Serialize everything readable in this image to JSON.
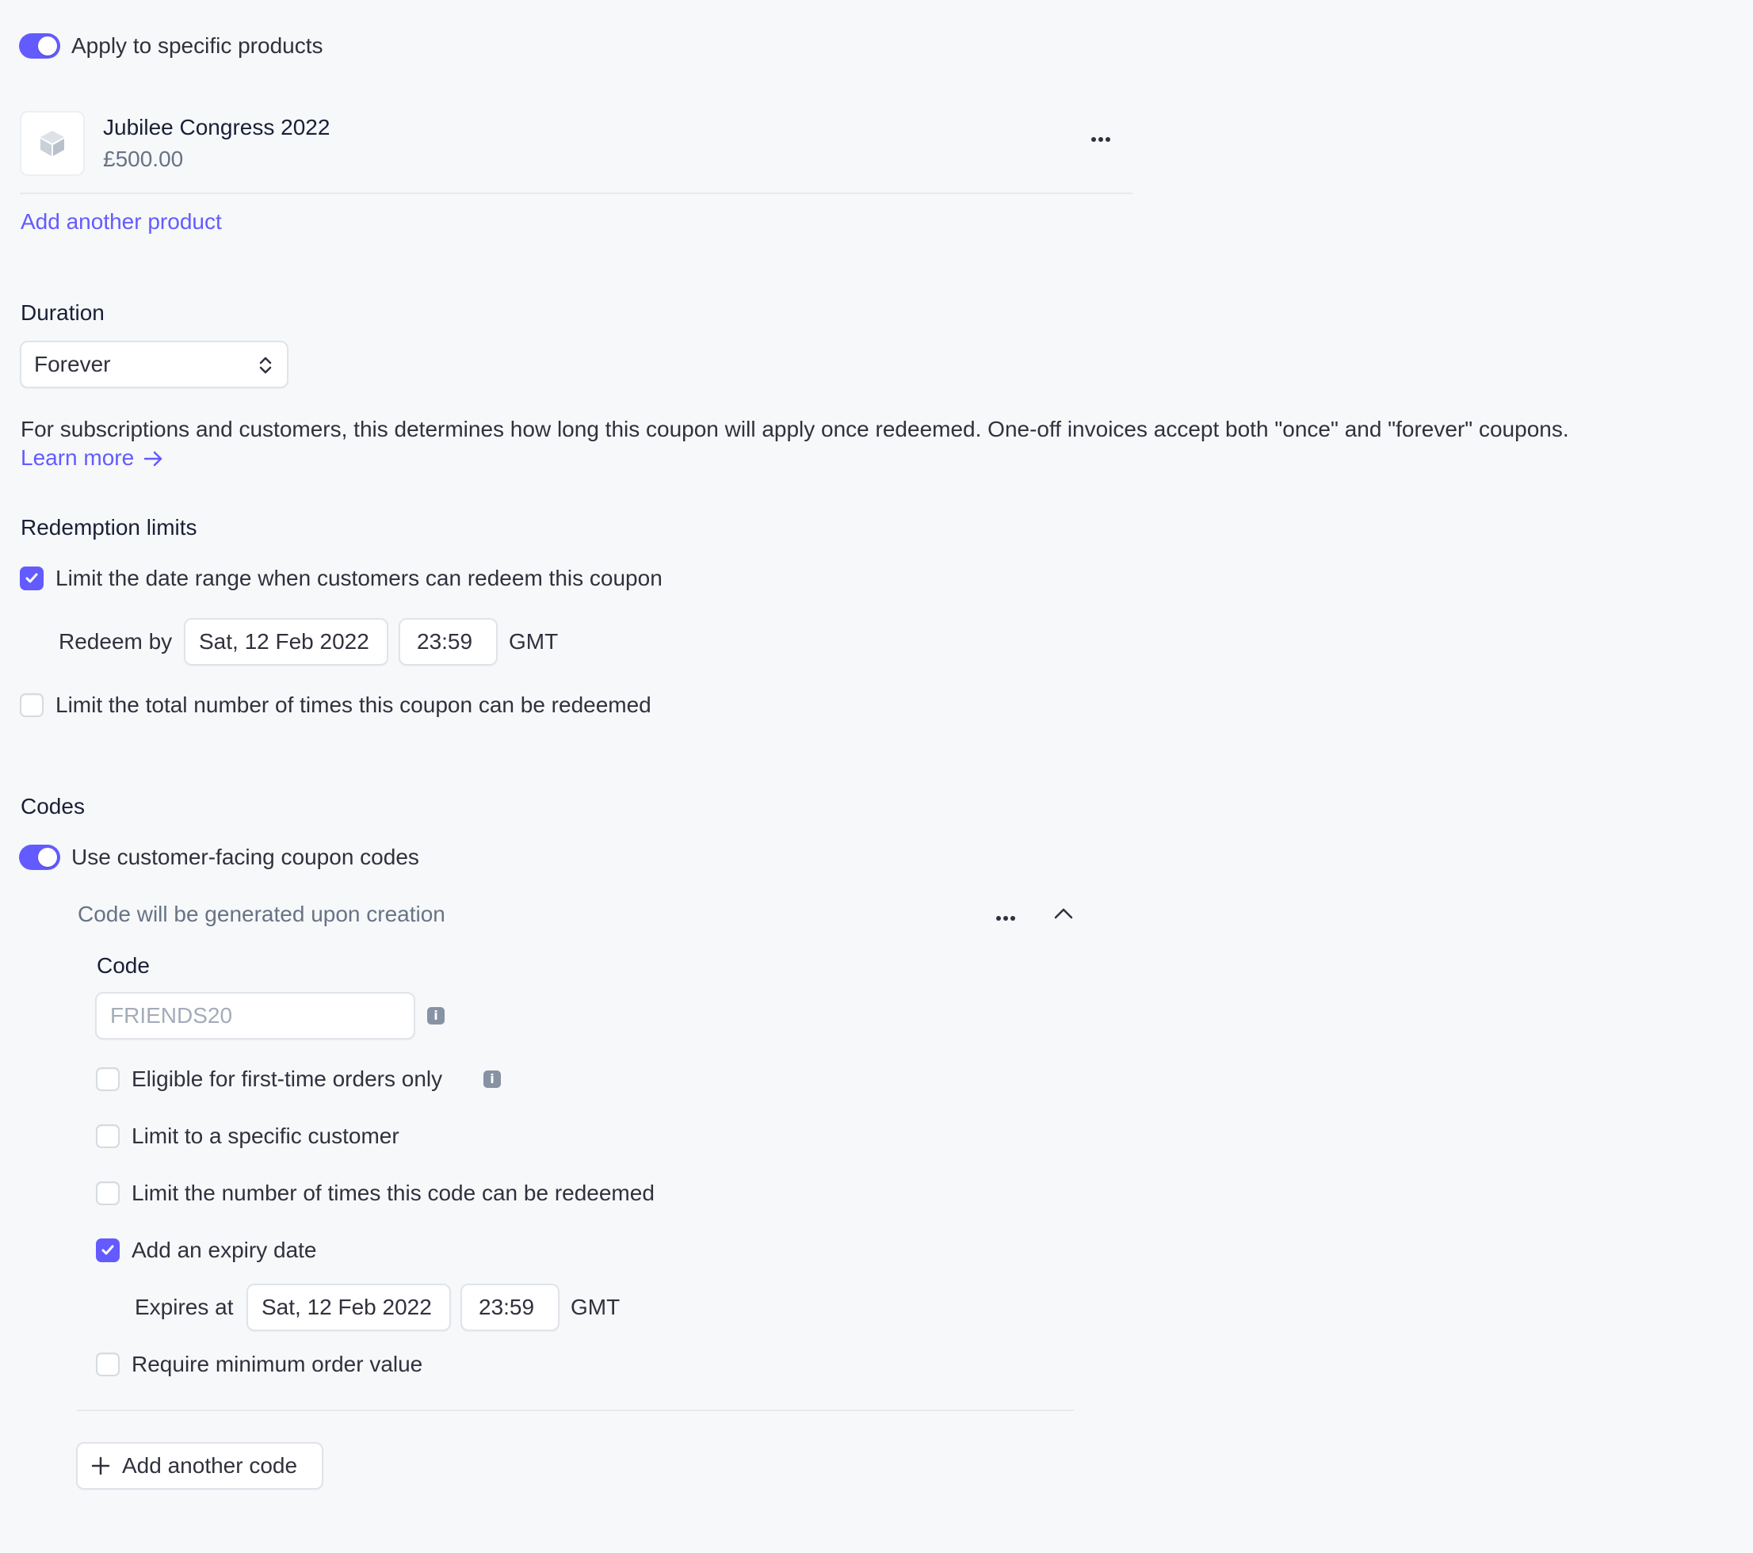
{
  "products_section": {
    "apply_toggle_label": "Apply to specific products",
    "product": {
      "name": "Jubilee Congress 2022",
      "price": "£500.00"
    },
    "add_product_link": "Add another product"
  },
  "duration": {
    "heading": "Duration",
    "selected": "Forever",
    "description": "For subscriptions and customers, this determines how long this coupon will apply once redeemed. One-off invoices accept both \"once\" and \"forever\" coupons.",
    "learn_more": "Learn more"
  },
  "redemption": {
    "heading": "Redemption limits",
    "date_range_label": "Limit the date range when customers can redeem this coupon",
    "date_range_checked": true,
    "redeem_by_label": "Redeem by",
    "redeem_by_date": "Sat, 12 Feb 2022",
    "redeem_by_time": "23:59",
    "timezone": "GMT",
    "total_times_label": "Limit the total number of times this coupon can be redeemed",
    "total_times_checked": false
  },
  "codes": {
    "heading": "Codes",
    "use_codes_label": "Use customer-facing coupon codes",
    "code_block_title": "Code will be generated upon creation",
    "code_label": "Code",
    "code_placeholder": "FRIENDS20",
    "first_time_label": "Eligible for first-time orders only",
    "specific_customer_label": "Limit to a specific customer",
    "limit_times_label": "Limit the number of times this code can be redeemed",
    "expiry_label": "Add an expiry date",
    "expires_at_label": "Expires at",
    "expires_date": "Sat, 12 Feb 2022",
    "expires_time": "23:59",
    "timezone": "GMT",
    "min_order_label": "Require minimum order value",
    "add_code_button": "Add another code"
  },
  "colors": {
    "accent": "#635bff",
    "background": "#f6f8fa"
  }
}
